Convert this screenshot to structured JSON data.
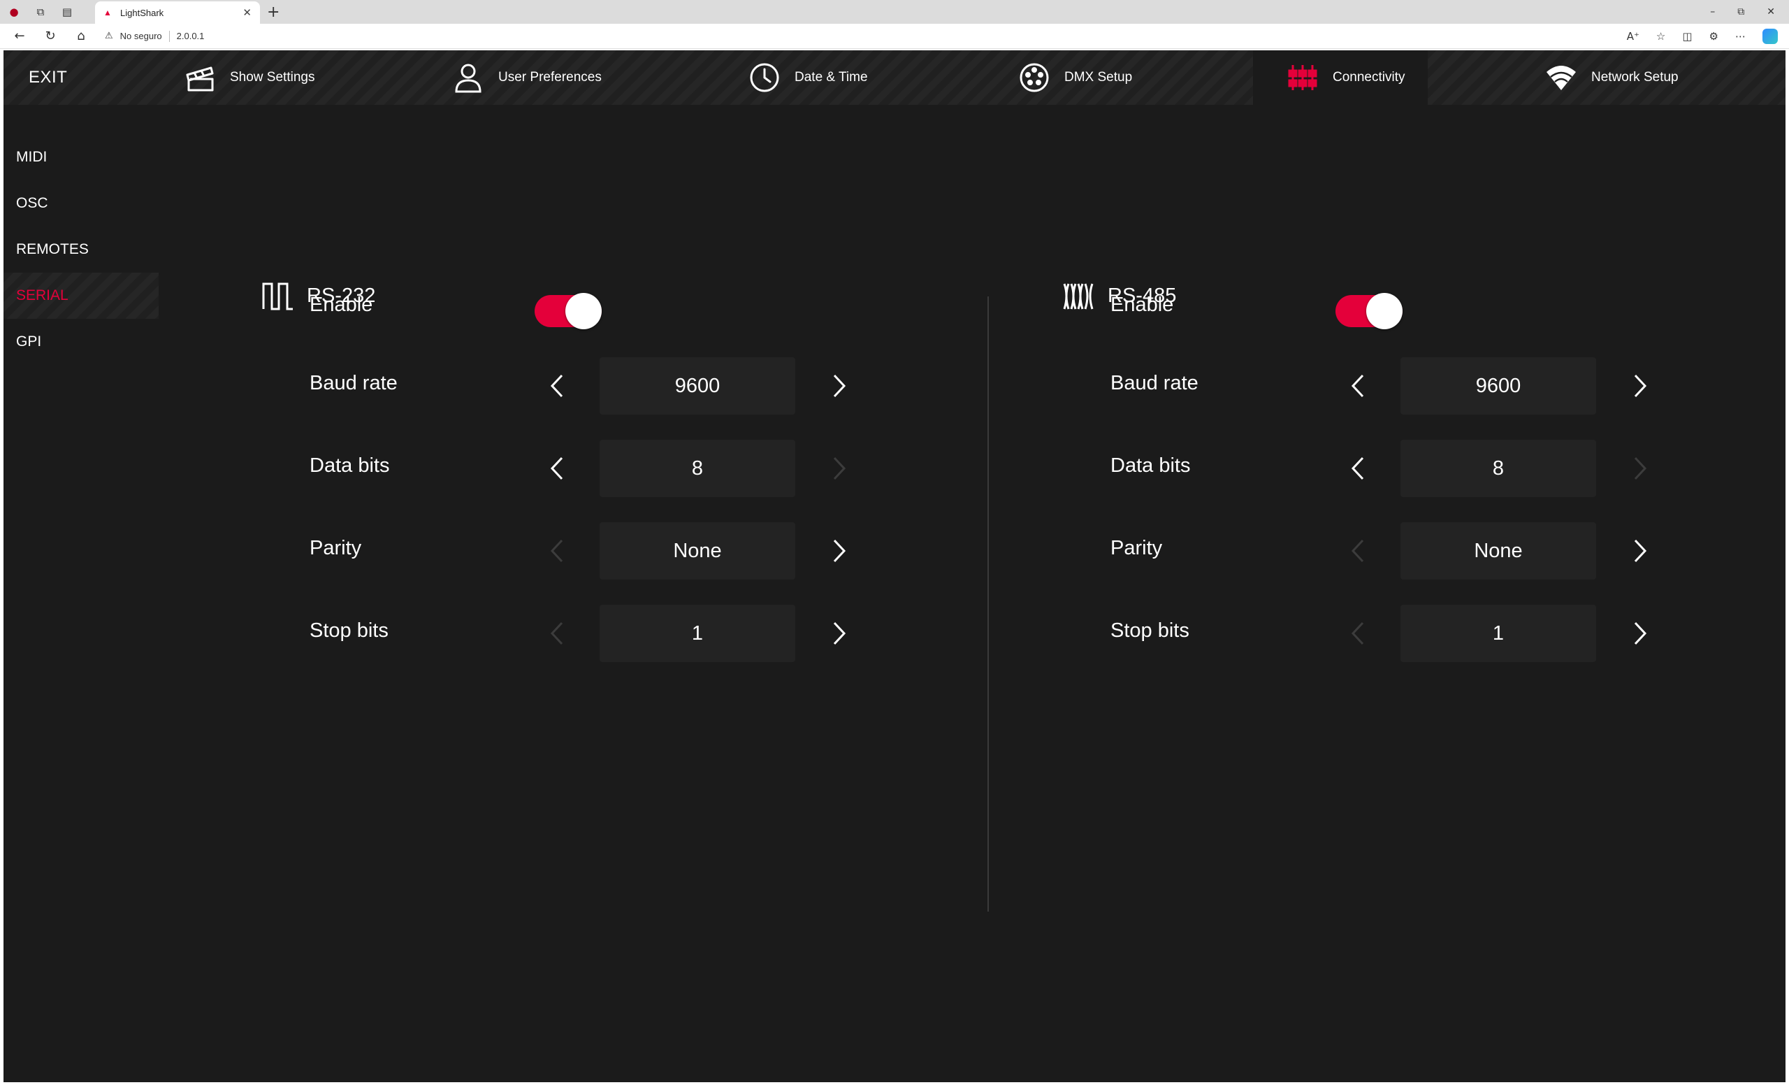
{
  "browser": {
    "tab_title": "LightShark",
    "security_label": "No seguro",
    "url": "2.0.0.1"
  },
  "app": {
    "exit_label": "EXIT",
    "menu": [
      {
        "label": "Show Settings",
        "icon": "show-settings-icon"
      },
      {
        "label": "User Preferences",
        "icon": "user-icon"
      },
      {
        "label": "Date & Time",
        "icon": "clock-icon"
      },
      {
        "label": "DMX Setup",
        "icon": "dmx-connector-icon"
      },
      {
        "label": "Connectivity",
        "icon": "connectivity-icon",
        "active": true
      },
      {
        "label": "Network Setup",
        "icon": "wifi-icon"
      }
    ],
    "sidebar": [
      {
        "label": "MIDI"
      },
      {
        "label": "OSC"
      },
      {
        "label": "REMOTES"
      },
      {
        "label": "SERIAL",
        "active": true
      },
      {
        "label": "GPI"
      }
    ],
    "accent_color": "#e4003a",
    "panels": [
      {
        "title": "RS-232",
        "enable_label": "Enable",
        "enabled": true,
        "rows": [
          {
            "label": "Baud rate",
            "value": "9600",
            "prev_enabled": true,
            "next_enabled": true
          },
          {
            "label": "Data bits",
            "value": "8",
            "prev_enabled": true,
            "next_enabled": false
          },
          {
            "label": "Parity",
            "value": "None",
            "prev_enabled": false,
            "next_enabled": true
          },
          {
            "label": "Stop bits",
            "value": "1",
            "prev_enabled": false,
            "next_enabled": true
          }
        ]
      },
      {
        "title": "RS-485",
        "enable_label": "Enable",
        "enabled": true,
        "rows": [
          {
            "label": "Baud rate",
            "value": "9600",
            "prev_enabled": true,
            "next_enabled": true
          },
          {
            "label": "Data bits",
            "value": "8",
            "prev_enabled": true,
            "next_enabled": false
          },
          {
            "label": "Parity",
            "value": "None",
            "prev_enabled": false,
            "next_enabled": true
          },
          {
            "label": "Stop bits",
            "value": "1",
            "prev_enabled": false,
            "next_enabled": true
          }
        ]
      }
    ]
  }
}
